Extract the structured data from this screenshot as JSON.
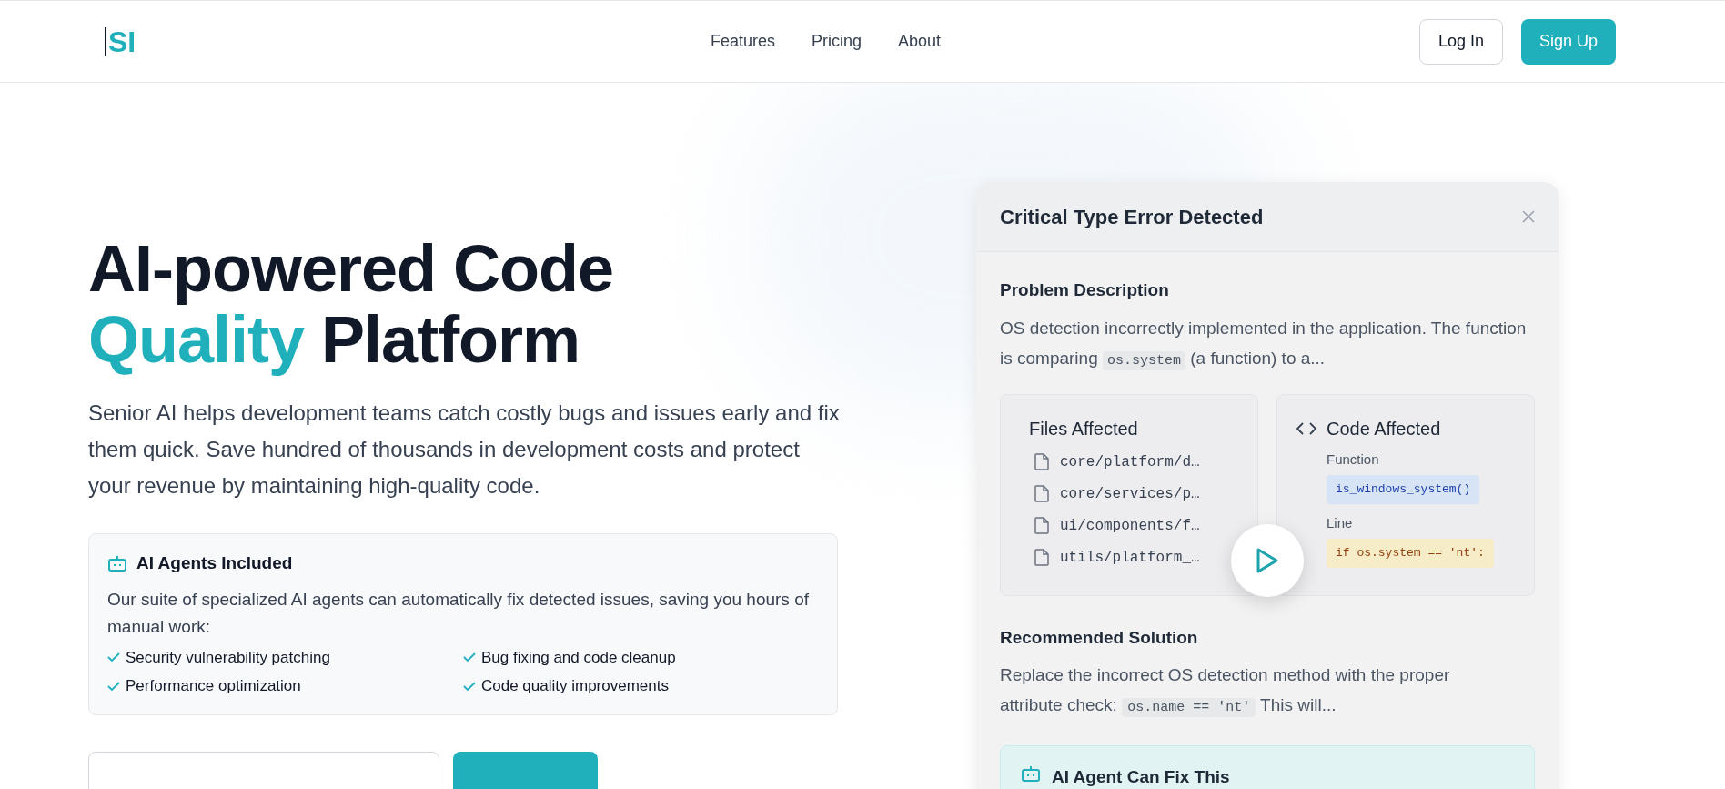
{
  "header": {
    "logo": "SI",
    "nav": [
      {
        "label": "Features"
      },
      {
        "label": "Pricing"
      },
      {
        "label": "About"
      }
    ],
    "login": "Log In",
    "signup": "Sign Up"
  },
  "hero": {
    "title_line1": "AI-powered Code",
    "title_accent": "Quality",
    "title_rest": "Platform",
    "description": "Senior AI helps development teams catch costly bugs and issues early and fix them quick. Save hundred of thousands in development costs and protect your revenue by maintaining high-quality code.",
    "agents": {
      "title": "AI Agents Included",
      "text": "Our suite of specialized AI agents can automatically fix detected issues, saving you hours of manual work:",
      "features": [
        "Security vulnerability patching",
        "Bug fixing and code cleanup",
        "Performance optimization",
        "Code quality improvements"
      ]
    }
  },
  "error_card": {
    "title": "Critical Type Error Detected",
    "problem_heading": "Problem Description",
    "problem_before": "OS detection incorrectly implemented in the application. The function is comparing",
    "problem_code": "os.system",
    "problem_after": "(a function) to a...",
    "files_heading": "Files Affected",
    "files": [
      "core/platform/d…",
      "core/services/p…",
      "ui/components/f…",
      "utils/platform_…"
    ],
    "code_heading": "Code Affected",
    "function_label": "Function",
    "function_code": "is_windows_system()",
    "line_label": "Line",
    "line_code": "if os.system == 'nt':",
    "solution_heading": "Recommended Solution",
    "solution_before": "Replace the incorrect OS detection method with the proper attribute check:",
    "solution_code": "os.name == 'nt'",
    "solution_after": "This will...",
    "agent_fix": "AI Agent Can Fix This"
  }
}
